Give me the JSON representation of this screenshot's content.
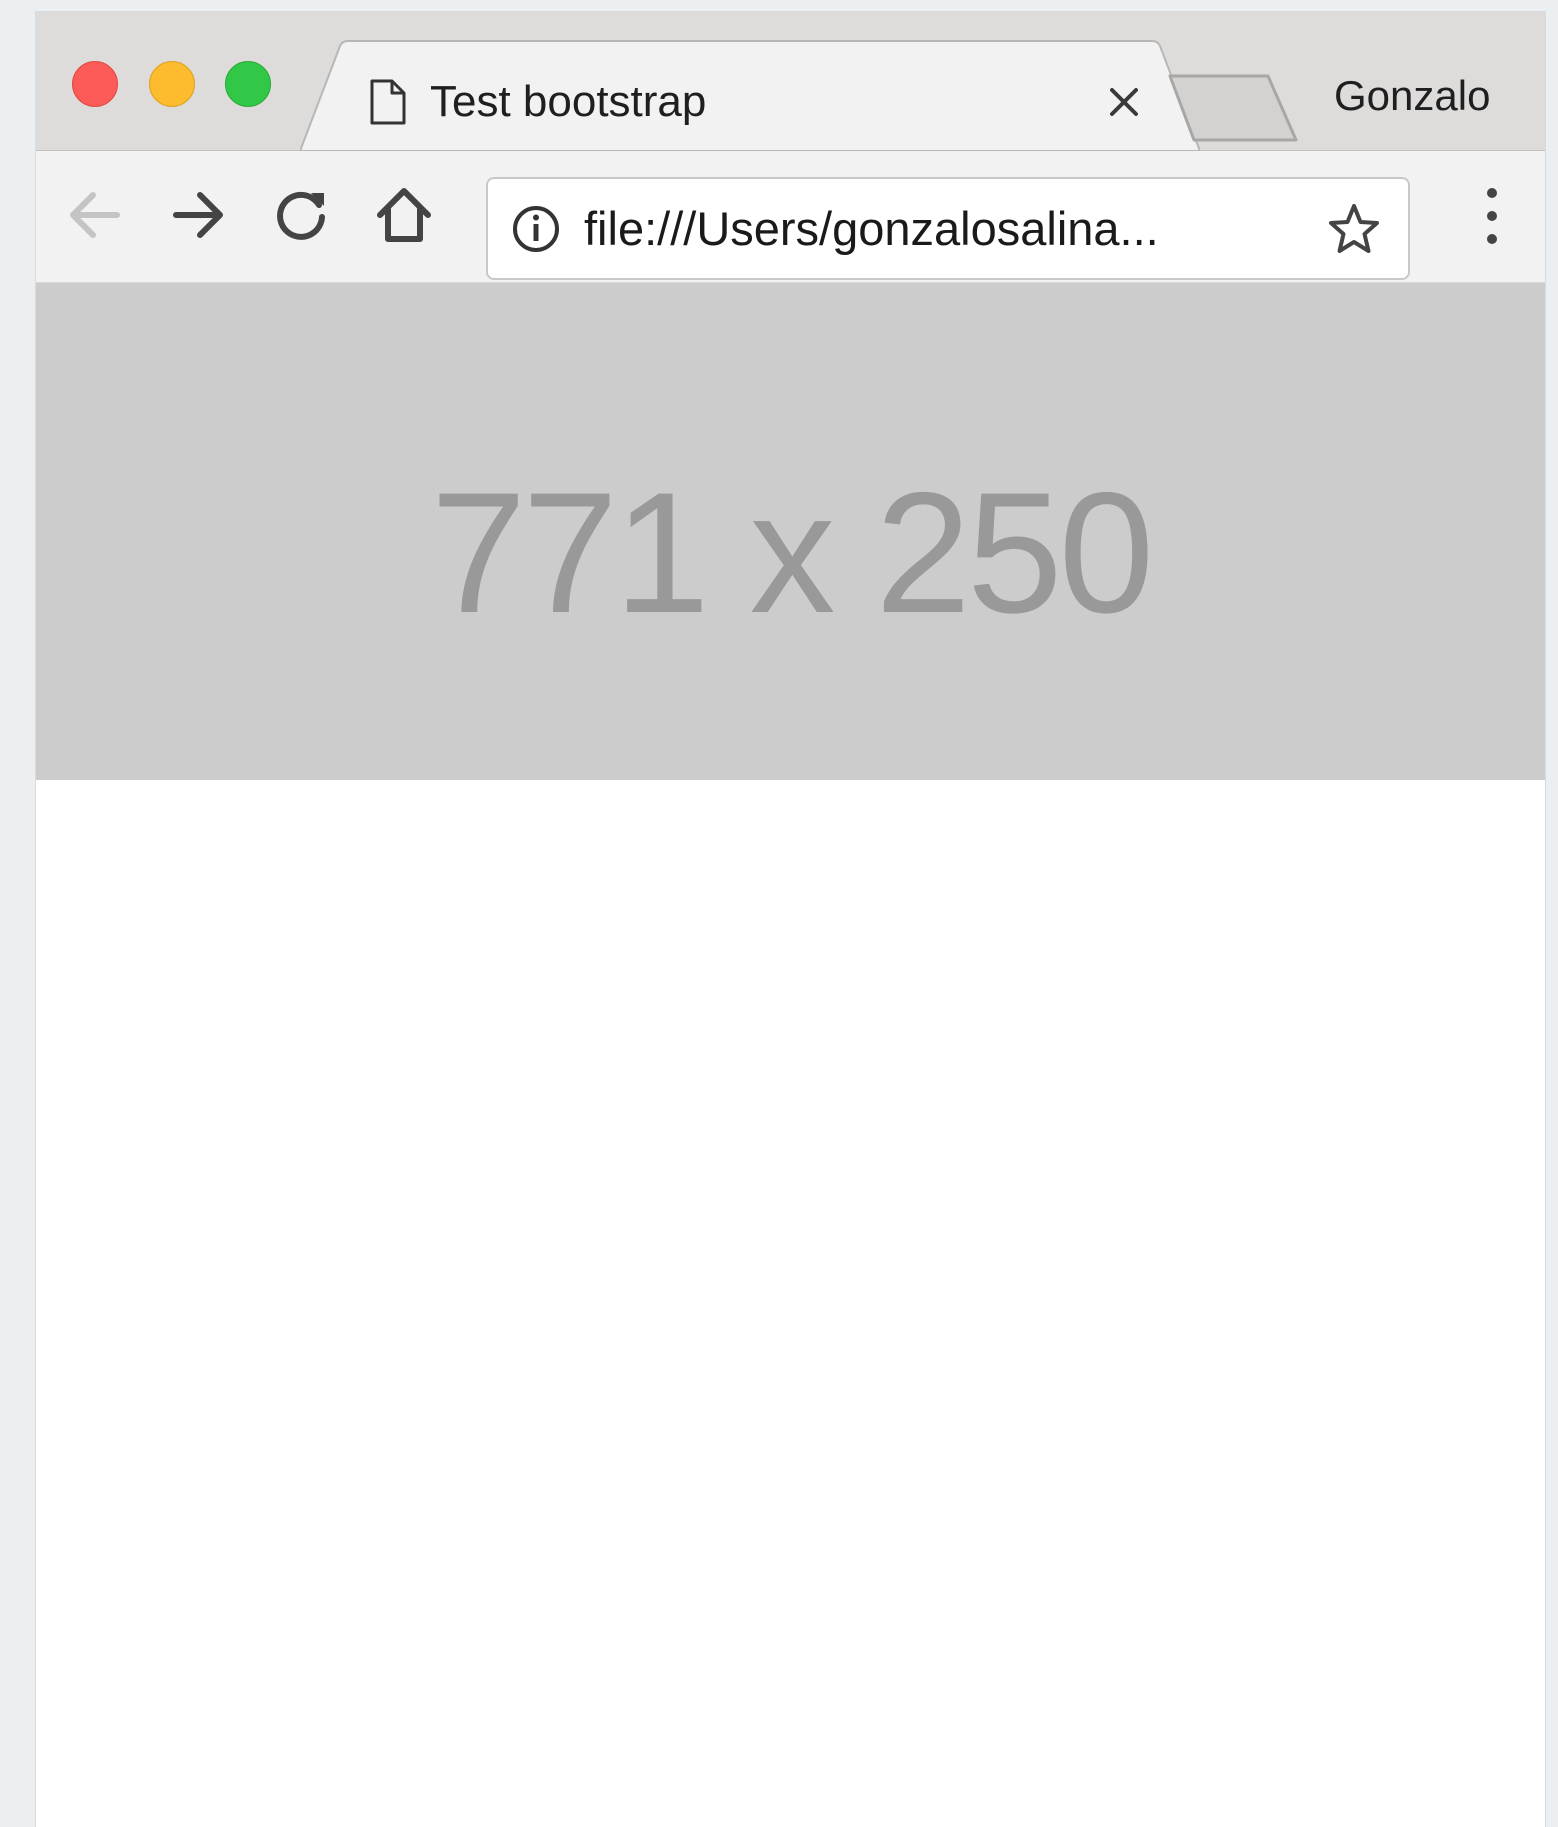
{
  "window": {
    "traffic_lights": [
      "close",
      "minimize",
      "zoom"
    ]
  },
  "tab": {
    "title": "Test bootstrap",
    "icon": "document-icon",
    "close_icon": "close-icon"
  },
  "profile": {
    "name": "Gonzalo"
  },
  "toolbar": {
    "back_icon": "arrow-left-icon",
    "forward_icon": "arrow-right-icon",
    "reload_icon": "reload-icon",
    "home_icon": "home-icon",
    "menu_icon": "kebab-menu-icon"
  },
  "omnibox": {
    "url": "file:///Users/gonzalosalina...",
    "info_icon": "info-icon",
    "bookmark_icon": "star-icon"
  },
  "page": {
    "placeholder_text": "771 x 250",
    "placeholder_bg": "#cccccc",
    "placeholder_fg": "#999999"
  },
  "colors": {
    "close": "#fc5b57",
    "minimize": "#fdbc2e",
    "zoom": "#33c748"
  }
}
